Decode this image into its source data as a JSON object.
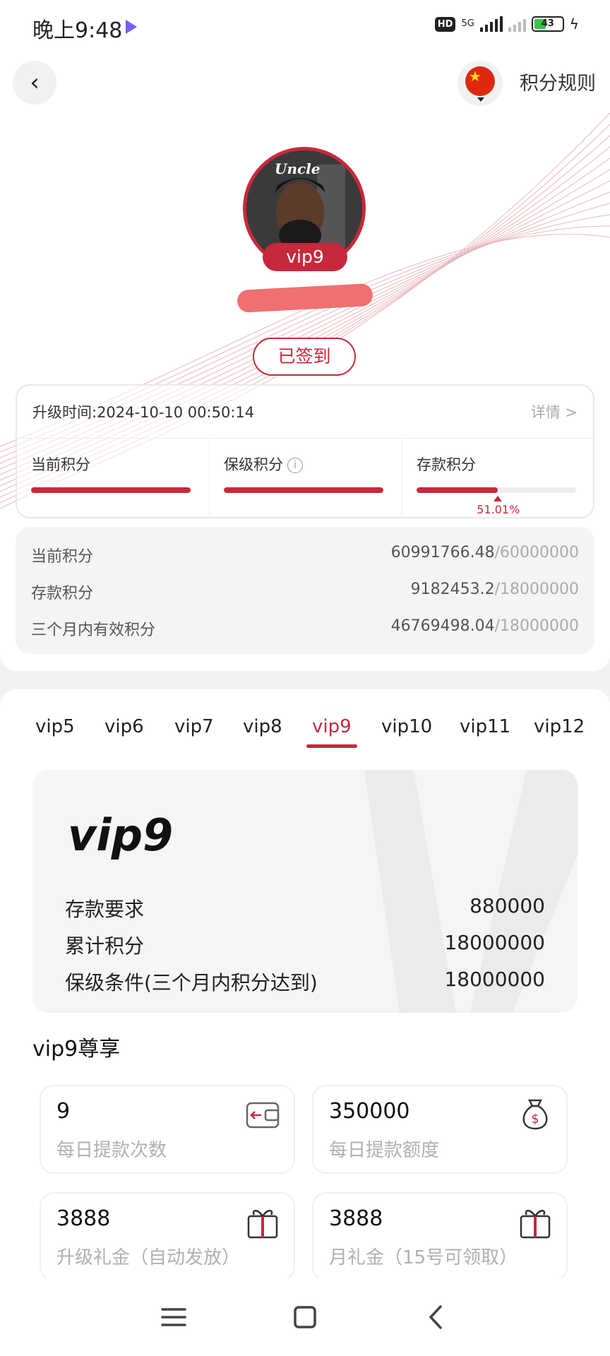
{
  "status_bar": {
    "time": "晚上9:48",
    "hd_badge": "HD",
    "network": "5G",
    "battery": "43",
    "battery_level": 0.43
  },
  "header": {
    "rules_label": "积分规则"
  },
  "profile": {
    "avatar_text": "Uncle",
    "vip_badge": "vip9",
    "signin_label": "已签到"
  },
  "level_card": {
    "upgrade_time": "升级时间:2024-10-10 00:50:14",
    "details_label": "详情 >",
    "columns": [
      {
        "label": "当前积分",
        "progress": 1.0
      },
      {
        "label": "保级积分",
        "progress": 1.0,
        "info_icon": "info-icon"
      },
      {
        "label": "存款积分",
        "progress": 0.5101,
        "percent_text": "51.01%"
      }
    ]
  },
  "points_summary": {
    "rows": [
      {
        "label": "当前积分",
        "value": "60991766.48",
        "max": "/60000000"
      },
      {
        "label": "存款积分",
        "value": "9182453.2",
        "max": "/18000000"
      },
      {
        "label": "三个月内有效积分",
        "value": "46769498.04",
        "max": "/18000000"
      }
    ]
  },
  "vip_tabs": [
    "vip5",
    "vip6",
    "vip7",
    "vip8",
    "vip9",
    "vip10",
    "vip11",
    "vip12"
  ],
  "active_tab": "vip9",
  "vip_card": {
    "title": "vip9",
    "rows": [
      {
        "label": "存款要求",
        "value": "880000"
      },
      {
        "label": "累计积分",
        "value": "18000000"
      },
      {
        "label": "保级条件(三个月内积分达到)",
        "value": "18000000"
      }
    ]
  },
  "perks": {
    "title": "vip9尊享",
    "items": [
      {
        "value": "9",
        "label": "每日提款次数",
        "icon": "wallet-icon"
      },
      {
        "value": "350000",
        "label": "每日提款额度",
        "icon": "money-bag-icon"
      },
      {
        "value": "3888",
        "label": "升级礼金（自动发放）",
        "icon": "gift-icon"
      },
      {
        "value": "3888",
        "label": "月礼金（15号可领取）",
        "icon": "gift-icon"
      }
    ]
  },
  "colors": {
    "accent": "#c6293b",
    "muted": "#aaaaaa"
  }
}
